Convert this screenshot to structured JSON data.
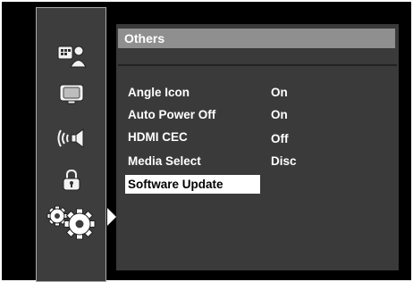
{
  "sidebar": {
    "icons": [
      {
        "name": "language-icon"
      },
      {
        "name": "display-icon"
      },
      {
        "name": "audio-icon"
      },
      {
        "name": "lock-icon"
      },
      {
        "name": "others-gears-icon",
        "selected": true
      }
    ]
  },
  "panel": {
    "title": "Others",
    "items": [
      {
        "label": "Angle Icon",
        "value": "On"
      },
      {
        "label": "Auto Power Off",
        "value": "On"
      },
      {
        "label": "HDMI CEC",
        "value": "Off"
      },
      {
        "label": "Media Select",
        "value": "Disc"
      },
      {
        "label": "Software Update",
        "value": "",
        "selected": true
      }
    ]
  },
  "colors": {
    "screen_bg": "#000000",
    "sidebar_bg": "#3d3d3d",
    "panel_bg": "#3a3a3a",
    "title_bar": "#8f8f8f",
    "highlight": "#ffffff",
    "text": "#ffffff"
  }
}
